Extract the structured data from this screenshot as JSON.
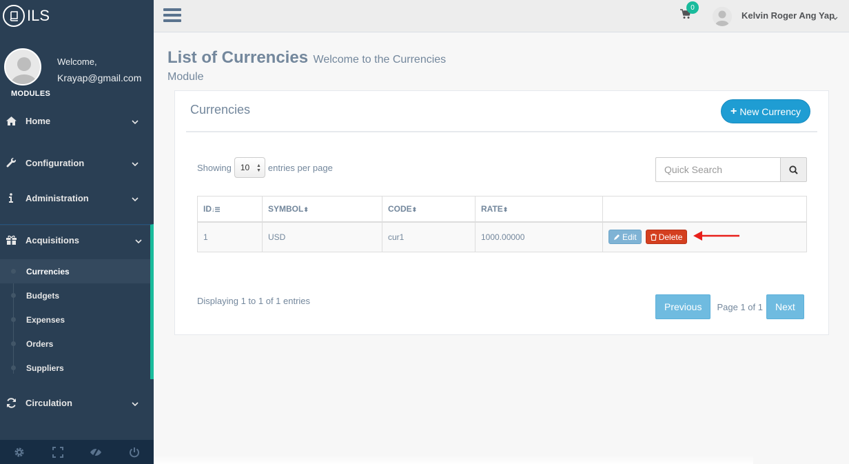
{
  "brand": {
    "name": "ILS"
  },
  "profile": {
    "welcome": "Welcome,",
    "email": "Krayap@gmail.com",
    "modules_label": "MODULES"
  },
  "nav": {
    "home": "Home",
    "configuration": "Configuration",
    "administration": "Administration",
    "acquisitions": "Acquisitions",
    "acquisitions_items": [
      "Currencies",
      "Budgets",
      "Expenses",
      "Orders",
      "Suppliers"
    ],
    "circulation": "Circulation"
  },
  "topbar": {
    "cart_count": "0",
    "user_name": "Kelvin Roger Ang Yap"
  },
  "page": {
    "title": "List of Currencies",
    "subtitle_part1": "Welcome to the Currencies",
    "subtitle_part2": "Module"
  },
  "panel": {
    "title": "Currencies",
    "new_button": "New Currency",
    "showing_label": "Showing",
    "entries_value": "10",
    "entries_label": "entries per page",
    "search_placeholder": "Quick Search",
    "columns": [
      "ID",
      "SYMBOL",
      "CODE",
      "RATE"
    ],
    "rows": [
      {
        "id": "1",
        "symbol": "USD",
        "code": "cur1",
        "rate": "1000.00000"
      }
    ],
    "edit_label": "Edit",
    "delete_label": "Delete",
    "display_info": "Displaying 1 to 1 of 1 entries",
    "previous": "Previous",
    "page_info": "Page 1 of 1",
    "next": "Next"
  },
  "colors": {
    "sidebar": "#2a3f54",
    "accent": "#1abb9c",
    "primary": "#1f9dd3",
    "danger": "#d43f1f",
    "edit": "#7fb3d5",
    "arrow": "#e8201b"
  }
}
